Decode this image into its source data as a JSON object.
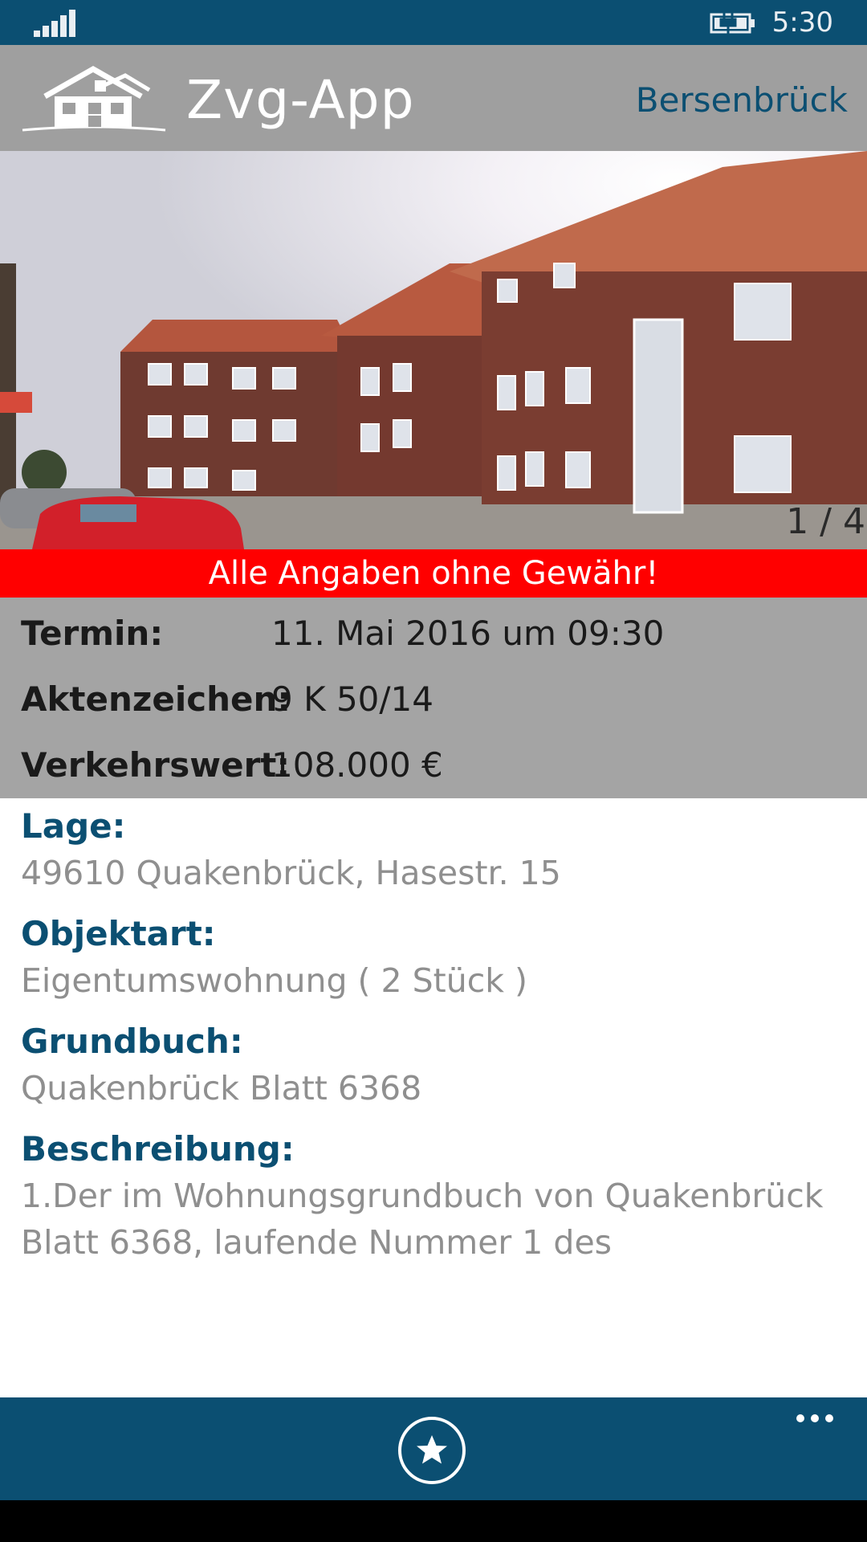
{
  "status_bar": {
    "time": "5:30",
    "icons": [
      "signal-icon",
      "battery-charging-icon"
    ]
  },
  "header": {
    "app_title": "Zvg-App",
    "location": "Bersenbrück",
    "logo": "house-logo-icon"
  },
  "gallery": {
    "counter": "1 / 4"
  },
  "disclaimer": "Alle Angaben ohne Gewähr!",
  "facts": [
    {
      "label": "Termin:",
      "value": "11. Mai 2016 um 09:30"
    },
    {
      "label": "Aktenzeichen:",
      "value": "9 K 50/14"
    },
    {
      "label": "Verkehrswert:",
      "value": "108.000 €"
    }
  ],
  "details": [
    {
      "label": "Lage:",
      "value": "49610 Quakenbrück, Hasestr. 15"
    },
    {
      "label": "Objektart:",
      "value": "Eigentumswohnung ( 2 Stück )"
    },
    {
      "label": "Grundbuch:",
      "value": "Quakenbrück Blatt 6368"
    },
    {
      "label": "Beschreibung:",
      "value": "1.Der im Wohnungsgrundbuch von Quakenbrück Blatt 6368, laufende Nummer 1 des"
    }
  ],
  "app_bar": {
    "favorite_icon": "star-circle-icon",
    "more_icon": "more-dots-icon"
  },
  "colors": {
    "accent": "#0b4f72",
    "header_bg": "#9f9f9f",
    "disclaimer_bg": "#ff0000",
    "facts_bg": "#a4a4a4",
    "detail_value": "#8f8f8f"
  }
}
